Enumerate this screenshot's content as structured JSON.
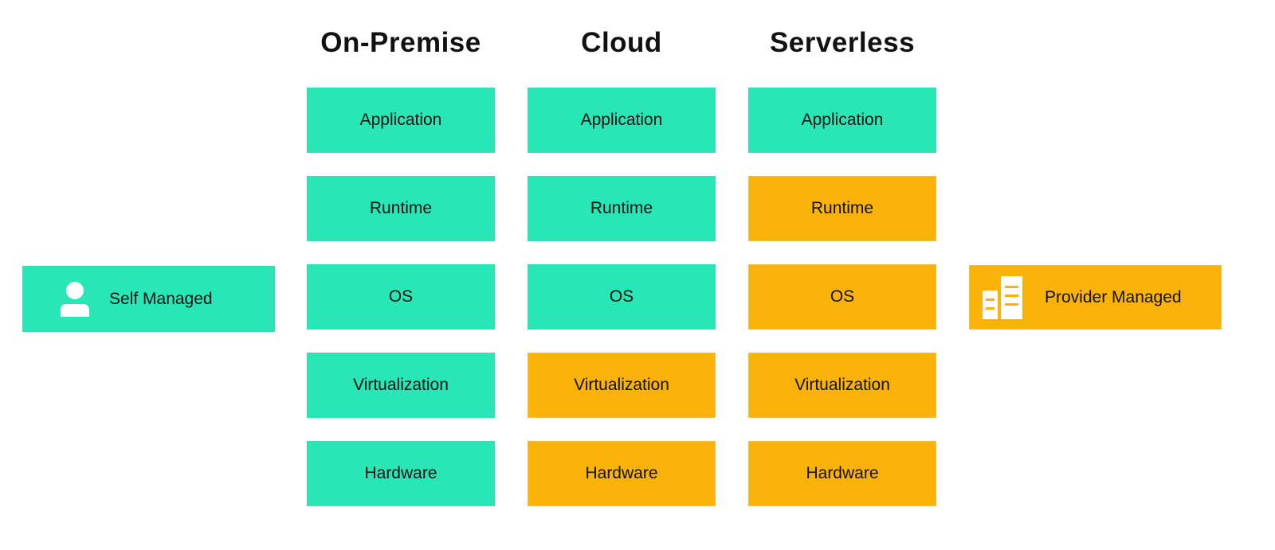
{
  "colors": {
    "self_managed": "#29E6B7",
    "provider_managed": "#F9B207"
  },
  "legend": {
    "self": {
      "label": "Self Managed",
      "icon": "user-icon"
    },
    "provider": {
      "label": "Provider Managed",
      "icon": "buildings-icon"
    }
  },
  "columns": [
    {
      "title": "On-Premise",
      "layers": [
        {
          "label": "Application",
          "managed": "self"
        },
        {
          "label": "Runtime",
          "managed": "self"
        },
        {
          "label": "OS",
          "managed": "self"
        },
        {
          "label": "Virtualization",
          "managed": "self"
        },
        {
          "label": "Hardware",
          "managed": "self"
        }
      ]
    },
    {
      "title": "Cloud",
      "layers": [
        {
          "label": "Application",
          "managed": "self"
        },
        {
          "label": "Runtime",
          "managed": "self"
        },
        {
          "label": "OS",
          "managed": "self"
        },
        {
          "label": "Virtualization",
          "managed": "provider"
        },
        {
          "label": "Hardware",
          "managed": "provider"
        }
      ]
    },
    {
      "title": "Serverless",
      "layers": [
        {
          "label": "Application",
          "managed": "self"
        },
        {
          "label": "Runtime",
          "managed": "provider"
        },
        {
          "label": "OS",
          "managed": "provider"
        },
        {
          "label": "Virtualization",
          "managed": "provider"
        },
        {
          "label": "Hardware",
          "managed": "provider"
        }
      ]
    }
  ]
}
